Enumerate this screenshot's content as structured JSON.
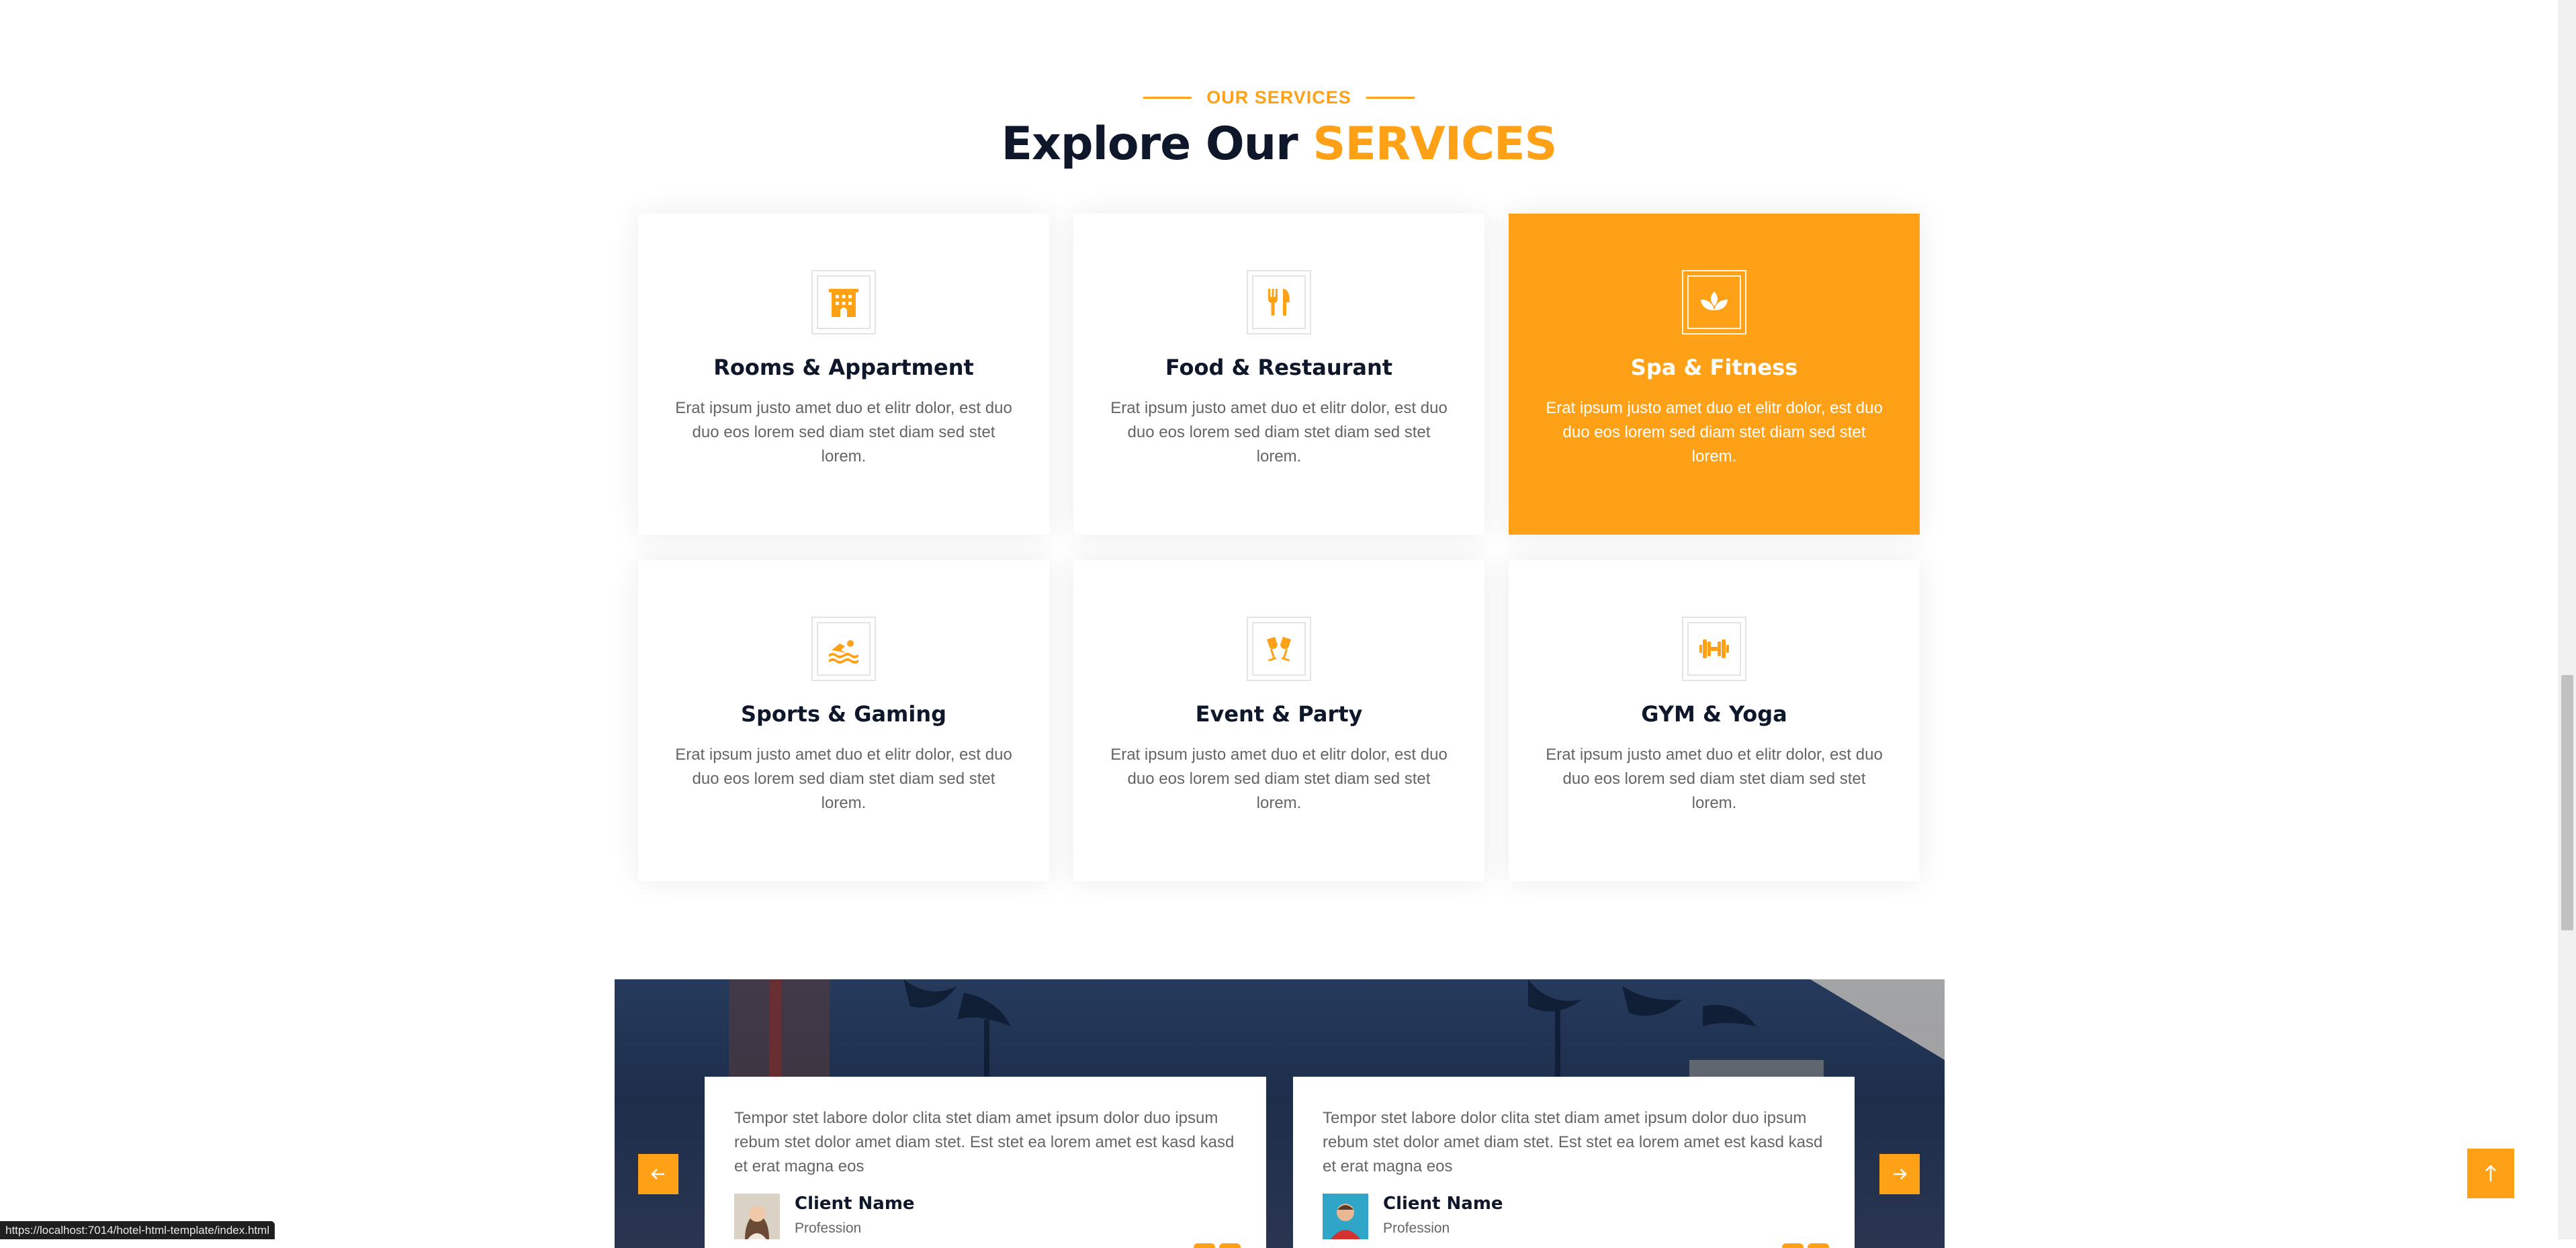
{
  "section": {
    "eyebrow": "OUR SERVICES",
    "heading_main": "Explore Our",
    "heading_accent": "SERVICES"
  },
  "services": [
    {
      "title": "Rooms & Appartment",
      "text": "Erat ipsum justo amet duo et elitr dolor, est duo duo eos lorem sed diam stet diam sed stet lorem.",
      "icon": "hotel-icon",
      "active": false
    },
    {
      "title": "Food & Restaurant",
      "text": "Erat ipsum justo amet duo et elitr dolor, est duo duo eos lorem sed diam stet diam sed stet lorem.",
      "icon": "utensils-icon",
      "active": false
    },
    {
      "title": "Spa & Fitness",
      "text": "Erat ipsum justo amet duo et elitr dolor, est duo duo eos lorem sed diam stet diam sed stet lorem.",
      "icon": "spa-icon",
      "active": true
    },
    {
      "title": "Sports & Gaming",
      "text": "Erat ipsum justo amet duo et elitr dolor, est duo duo eos lorem sed diam stet diam sed stet lorem.",
      "icon": "swimmer-icon",
      "active": false
    },
    {
      "title": "Event & Party",
      "text": "Erat ipsum justo amet duo et elitr dolor, est duo duo eos lorem sed diam stet diam sed stet lorem.",
      "icon": "glass-cheers-icon",
      "active": false
    },
    {
      "title": "GYM & Yoga",
      "text": "Erat ipsum justo amet duo et elitr dolor, est duo duo eos lorem sed diam stet diam sed stet lorem.",
      "icon": "dumbbell-icon",
      "active": false
    }
  ],
  "testimonials": [
    {
      "text": "Tempor stet labore dolor clita stet diam amet ipsum dolor duo ipsum rebum stet dolor amet diam stet. Est stet ea lorem amet est kasd kasd et erat magna eos",
      "name": "Client Name",
      "profession": "Profession",
      "avatar": "female-avatar"
    },
    {
      "text": "Tempor stet labore dolor clita stet diam amet ipsum dolor duo ipsum rebum stet dolor amet diam stet. Est stet ea lorem amet est kasd kasd et erat magna eos",
      "name": "Client Name",
      "profession": "Profession",
      "avatar": "male-avatar"
    }
  ],
  "status_url": "https://localhost:7014/hotel-html-template/index.html",
  "colors": {
    "primary": "#FEA116",
    "dark": "#0F172B",
    "text": "#666565"
  }
}
